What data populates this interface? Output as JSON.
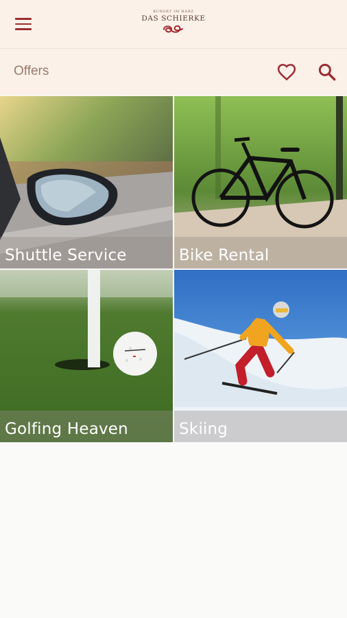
{
  "header": {
    "logo_small": "KURORT IM HARZ",
    "logo_main": "DAS SCHIERKE",
    "menu_icon": "hamburger-menu-icon",
    "brand_color": "#9b2d33"
  },
  "subheader": {
    "title": "Offers",
    "favorites_icon": "heart-icon",
    "search_icon": "search-icon"
  },
  "offers": [
    {
      "label": "Shuttle Service"
    },
    {
      "label": "Bike Rental"
    },
    {
      "label": "Golfing Heaven"
    },
    {
      "label": "Skiing"
    }
  ]
}
